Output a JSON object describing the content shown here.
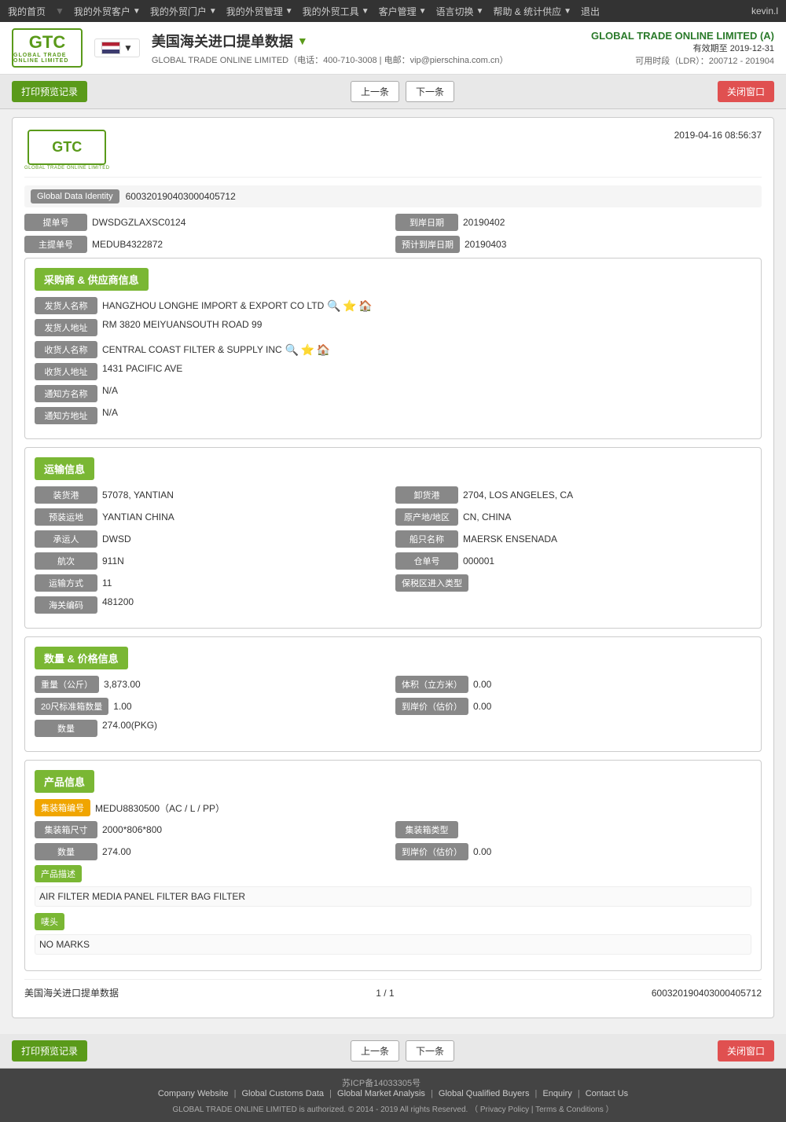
{
  "topnav": {
    "items": [
      {
        "label": "我的首页",
        "id": "home"
      },
      {
        "label": "我的外贸客户",
        "id": "customers"
      },
      {
        "label": "我的外贸门户",
        "id": "portal"
      },
      {
        "label": "我的外贸管理",
        "id": "management"
      },
      {
        "label": "我的外贸工具",
        "id": "tools"
      },
      {
        "label": "客户管理",
        "id": "client-mgmt"
      },
      {
        "label": "语言切换",
        "id": "language"
      },
      {
        "label": "帮助 & 统计供应",
        "id": "help"
      },
      {
        "label": "退出",
        "id": "logout"
      }
    ],
    "user": "kevin.l"
  },
  "header": {
    "logo_text": "GTC",
    "logo_sub": "GLOBAL TRADE ONLINE LIMITED",
    "flag_alt": "US Flag",
    "title": "美国海关进口提单数据",
    "subtitle": "GLOBAL TRADE ONLINE LIMITED（电话：400-710-3008 | 电邮：vip@pierschina.com.cn）",
    "company_name": "GLOBAL TRADE ONLINE LIMITED (A)",
    "valid_until": "有效期至 2019-12-31",
    "ldr": "可用时段（LDR）：200712 - 201904"
  },
  "toolbar": {
    "print_btn": "打印预览记录",
    "prev_btn": "上一条",
    "next_btn": "下一条",
    "close_btn": "关闭窗口"
  },
  "record": {
    "timestamp": "2019-04-16 08:56:37",
    "logo_text": "GTC",
    "logo_sub": "GLOBAL TRADE ONLINE LIMITED",
    "gdi_label": "Global Data Identity",
    "gdi_value": "600320190403000405712",
    "bill_no_label": "提单号",
    "bill_no_value": "DWSDGZLAXSC0124",
    "departure_date_label": "到岸日期",
    "departure_date_value": "20190402",
    "master_bill_label": "主提单号",
    "master_bill_value": "MEDUB4322872",
    "planned_date_label": "预计到岸日期",
    "planned_date_value": "20190403"
  },
  "buyer_supplier": {
    "section_title": "采购商 & 供应商信息",
    "shipper_name_label": "发货人名称",
    "shipper_name_value": "HANGZHOU LONGHE IMPORT & EXPORT CO LTD",
    "shipper_addr_label": "发货人地址",
    "shipper_addr_value": "RM 3820 MEIYUANSOUTH ROAD 99",
    "consignee_name_label": "收货人名称",
    "consignee_name_value": "CENTRAL COAST FILTER & SUPPLY INC",
    "consignee_addr_label": "收货人地址",
    "consignee_addr_value": "1431 PACIFIC AVE",
    "notify_name_label": "通知方名称",
    "notify_name_value": "N/A",
    "notify_addr_label": "通知方地址",
    "notify_addr_value": "N/A"
  },
  "transport": {
    "section_title": "运输信息",
    "loading_port_label": "装货港",
    "loading_port_value": "57078, YANTIAN",
    "discharge_port_label": "卸货港",
    "discharge_port_value": "2704, LOS ANGELES, CA",
    "pre_carriage_label": "预装运地",
    "pre_carriage_value": "YANTIAN CHINA",
    "origin_country_label": "原产地/地区",
    "origin_country_value": "CN, CHINA",
    "carrier_label": "承运人",
    "carrier_value": "DWSD",
    "vessel_name_label": "船只名称",
    "vessel_name_value": "MAERSK ENSENADA",
    "voyage_label": "航次",
    "voyage_value": "911N",
    "container_no_label": "仓单号",
    "container_no_value": "000001",
    "transport_mode_label": "运输方式",
    "transport_mode_value": "11",
    "bonded_zone_label": "保税区进入类型",
    "bonded_zone_value": "",
    "shipping_marks_label": "海关编码",
    "shipping_marks_value": "481200"
  },
  "quantity_price": {
    "section_title": "数量 & 价格信息",
    "weight_label": "重量（公斤）",
    "weight_value": "3,873.00",
    "volume_label": "体积（立方米）",
    "volume_value": "0.00",
    "container_20ft_label": "20尺标准箱数量",
    "container_20ft_value": "1.00",
    "unit_price_label": "到岸价（估价）",
    "unit_price_value": "0.00",
    "quantity_label": "数量",
    "quantity_value": "274.00(PKG)"
  },
  "product": {
    "section_title": "产品信息",
    "container_id_label": "集装箱编号",
    "container_id_value": "MEDU8830500（AC / L / PP）",
    "container_size_label": "集装箱尺寸",
    "container_size_value": "2000*806*800",
    "container_type_label": "集装箱类型",
    "container_type_value": "",
    "quantity_label": "数量",
    "quantity_value": "274.00",
    "unit_price_label": "到岸价（估价）",
    "unit_price_value": "0.00",
    "desc_label": "产品描述",
    "desc_value": "AIR FILTER MEDIA PANEL FILTER BAG FILTER",
    "marks_label": "唛头",
    "marks_value": "NO MARKS"
  },
  "record_footer": {
    "source": "美国海关进口提单数据",
    "page": "1 / 1",
    "id": "600320190403000405712"
  },
  "page_footer": {
    "icp": "苏ICP备14033305号",
    "links": [
      "Company Website",
      "Global Customs Data",
      "Global Market Analysis",
      "Global Qualified Buyers",
      "Enquiry",
      "Contact Us"
    ],
    "copyright": "GLOBAL TRADE ONLINE LIMITED is authorized. © 2014 - 2019 All rights Reserved.  （ Privacy Policy | Terms & Conditions ）"
  }
}
